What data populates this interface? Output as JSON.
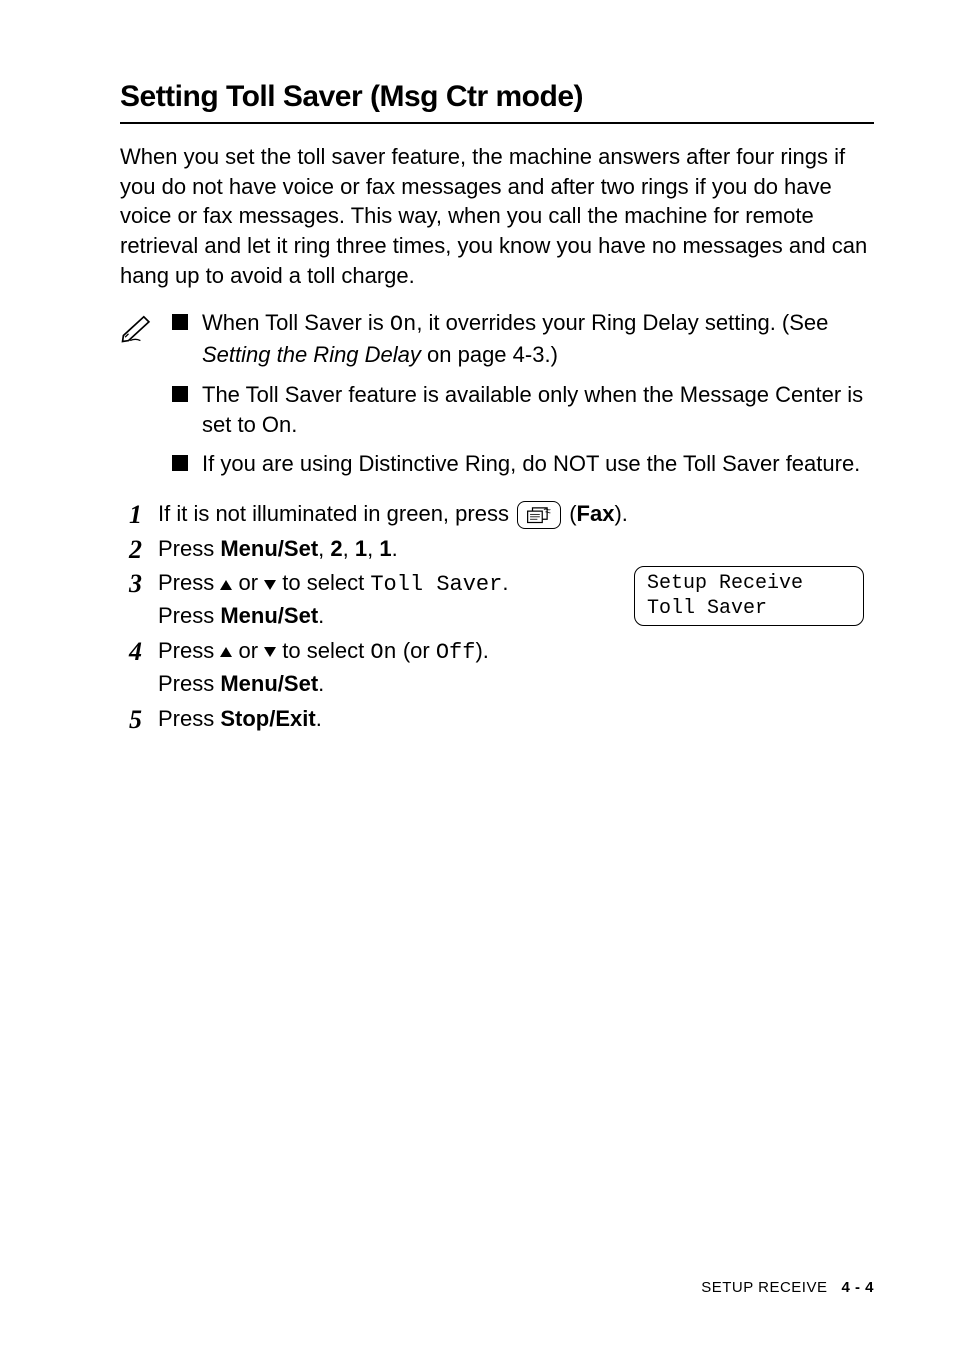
{
  "heading": "Setting Toll Saver (Msg Ctr mode)",
  "intro": "When you set the toll saver feature, the machine answers after four rings if you do not have voice or fax messages and after two rings if you do have voice or fax messages. This way, when you call the machine for remote retrieval and let it ring three times, you know you have no messages and can hang up to avoid a toll charge.",
  "notes": {
    "b0": {
      "pre": "When Toll Saver is ",
      "code": "On",
      "mid": ", it overrides your Ring Delay setting. (See ",
      "italic": "Setting the Ring Delay",
      "post": " on page 4-3.)"
    },
    "b1": "The Toll Saver feature is available only when the Message Center is set to On.",
    "b2": "If you are using Distinctive Ring, do NOT use the Toll Saver feature."
  },
  "steps": {
    "s1": {
      "num": "1",
      "pre": "If it is not illuminated in green, press ",
      "post_open": " (",
      "fax": "Fax",
      "post_close": ")."
    },
    "s2": {
      "num": "2",
      "pre": "Press ",
      "key": "Menu/Set",
      "seq": ", 2, 1, 1",
      "seq_sep1": ", ",
      "k2": "2",
      "k3": "1",
      "k4": "1",
      "end": "."
    },
    "s3": {
      "num": "3",
      "l1a": "Press ",
      "l1b": " or ",
      "l1c": " to select ",
      "code": "Toll Saver",
      "l1d": ".",
      "l2a": "Press ",
      "key": "Menu/Set",
      "l2b": "."
    },
    "s4": {
      "num": "4",
      "l1a": "Press ",
      "l1b": " or ",
      "l1c": " to select ",
      "codeOn": "On",
      "l1d": " (or ",
      "codeOff": "Off",
      "l1e": ").",
      "l2a": "Press ",
      "key": "Menu/Set",
      "l2b": "."
    },
    "s5": {
      "num": "5",
      "pre": "Press ",
      "key": "Stop/Exit",
      "post": "."
    }
  },
  "lcd": {
    "line1": "Setup Receive",
    "line2": "Toll Saver"
  },
  "footer": {
    "section": "SETUP RECEIVE",
    "page": "4 - 4"
  }
}
